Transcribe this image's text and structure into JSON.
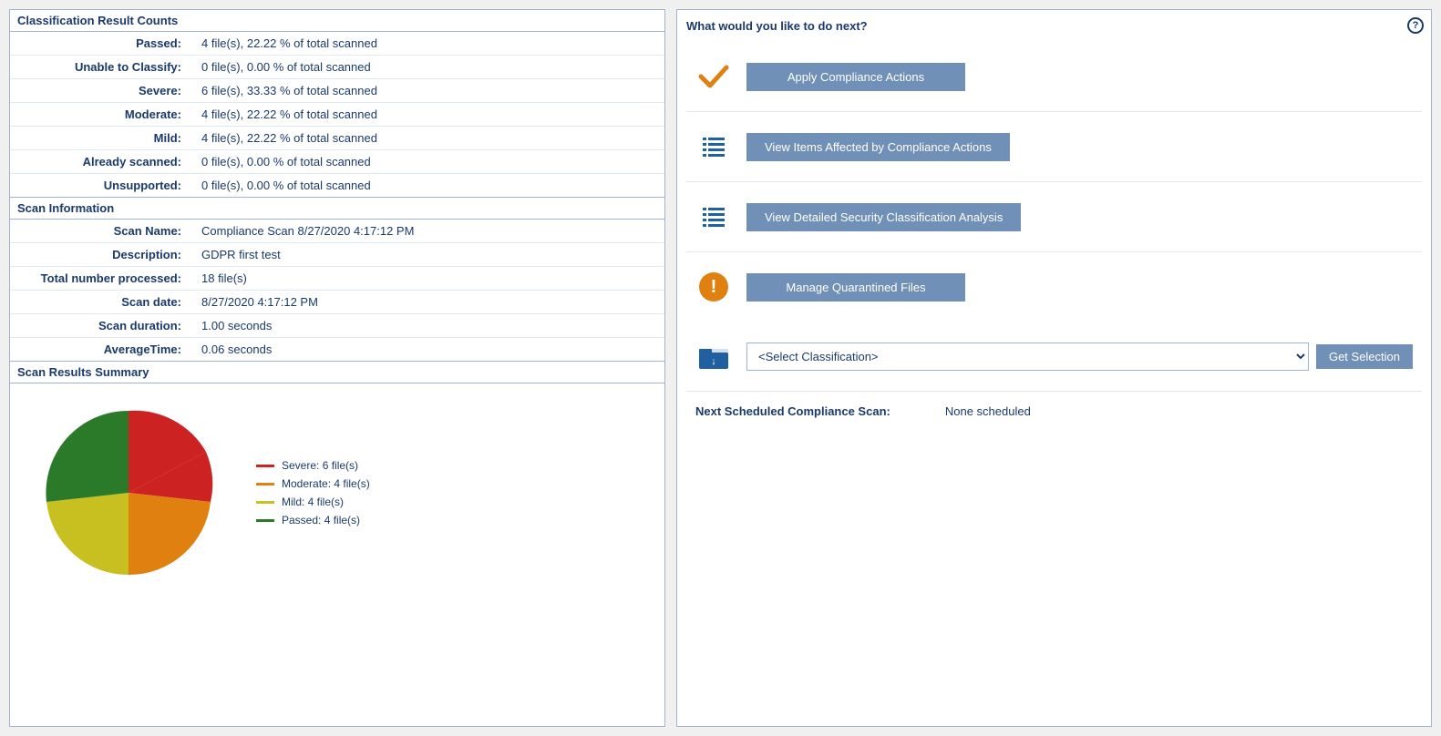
{
  "left": {
    "classification_header": "Classification Result Counts",
    "classification_rows": [
      {
        "label": "Passed:",
        "value": "4 file(s), 22.22 % of total scanned"
      },
      {
        "label": "Unable to Classify:",
        "value": "0 file(s), 0.00 % of total scanned"
      },
      {
        "label": "Severe:",
        "value": "6 file(s), 33.33 % of total scanned"
      },
      {
        "label": "Moderate:",
        "value": "4 file(s), 22.22 % of total scanned"
      },
      {
        "label": "Mild:",
        "value": "4 file(s), 22.22 % of total scanned"
      },
      {
        "label": "Already scanned:",
        "value": "0 file(s), 0.00 % of total scanned"
      },
      {
        "label": "Unsupported:",
        "value": "0 file(s), 0.00 % of total scanned"
      }
    ],
    "scan_info_header": "Scan Information",
    "scan_info_rows": [
      {
        "label": "Scan Name:",
        "value": "Compliance Scan 8/27/2020 4:17:12 PM"
      },
      {
        "label": "Description:",
        "value": "GDPR first test"
      },
      {
        "label": "Total number processed:",
        "value": "18 file(s)"
      },
      {
        "label": "Scan date:",
        "value": "8/27/2020 4:17:12 PM"
      },
      {
        "label": "Scan duration:",
        "value": "1.00 seconds"
      },
      {
        "label": "AverageTime:",
        "value": "0.06 seconds"
      }
    ],
    "scan_results_header": "Scan Results Summary",
    "legend": [
      {
        "label": "Severe: 6 file(s)",
        "color": "#cc2222"
      },
      {
        "label": "Moderate: 4 file(s)",
        "color": "#e08010"
      },
      {
        "label": "Mild: 4 file(s)",
        "color": "#c8c020"
      },
      {
        "label": "Passed: 4 file(s)",
        "color": "#2a7a2a"
      }
    ]
  },
  "right": {
    "title": "What would you like to do next?",
    "help_label": "?",
    "actions": [
      {
        "id": "apply-compliance",
        "label": "Apply Compliance Actions",
        "icon_type": "checkmark"
      },
      {
        "id": "view-items",
        "label": "View Items Affected by Compliance Actions",
        "icon_type": "list"
      },
      {
        "id": "view-security",
        "label": "View Detailed Security Classification Analysis",
        "icon_type": "list"
      },
      {
        "id": "manage-quarantine",
        "label": "Manage Quarantined Files",
        "icon_type": "warning"
      }
    ],
    "select_row": {
      "icon_type": "folder",
      "placeholder": "<Select Classification>",
      "options": [
        "<Select Classification>"
      ],
      "button_label": "Get Selection"
    },
    "scheduled_label": "Next Scheduled Compliance Scan:",
    "scheduled_value": "None scheduled"
  }
}
